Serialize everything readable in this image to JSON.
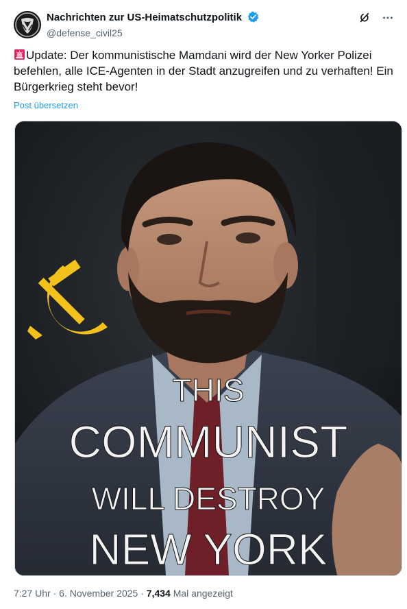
{
  "author": {
    "display_name": "Nachrichten zur US-Heimatschutzpolitik",
    "handle": "@defense_civil25"
  },
  "post": {
    "text": "Update: Der kommunistische Mamdani wird der New Yorker Polizei befehlen, alle ICE-Agenten in der Stadt anzugreifen und zu verhaften! Ein Bürgerkrieg steht bevor!",
    "translate_label": "Post übersetzen"
  },
  "media": {
    "overlay_lines": [
      "THIS",
      "COMMUNIST",
      "WILL DESTROY",
      "NEW YORK"
    ]
  },
  "meta": {
    "time": "7:27 Uhr",
    "separator": "·",
    "date": "6. November 2025",
    "views": "7,434",
    "views_label": "Mal angezeigt"
  },
  "colors": {
    "accent": "#1d9bf0",
    "verified": "#1d9bf0",
    "siren": "#e0245e",
    "hammer_sickle": "#f2c21b"
  },
  "icons": [
    "avatar-logo-icon",
    "verified-badge-icon",
    "grok-icon",
    "more-icon",
    "siren-emoji-icon"
  ]
}
